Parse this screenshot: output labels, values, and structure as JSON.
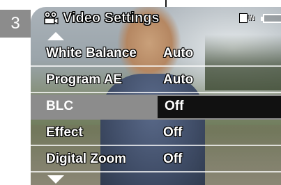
{
  "step_number": "3",
  "title_bar": {
    "title": "Video Settings",
    "mode_icon_text": "IN",
    "icons": [
      "video-camera-icon",
      "memory-mode-icon",
      "battery-icon"
    ]
  },
  "menu": {
    "items": [
      {
        "label": "White Balance",
        "value": "Auto",
        "selected": false
      },
      {
        "label": "Program AE",
        "value": "Auto",
        "selected": false
      },
      {
        "label": "BLC",
        "value": "Off",
        "selected": true
      },
      {
        "label": "Effect",
        "value": "Off",
        "selected": false
      },
      {
        "label": "Digital Zoom",
        "value": "Off",
        "selected": false
      }
    ]
  },
  "colors": {
    "selected_row": "#8c8c8c",
    "selected_value_bg": "#111111",
    "badge_bg": "#8c8c8c",
    "text": "#ffffff"
  }
}
